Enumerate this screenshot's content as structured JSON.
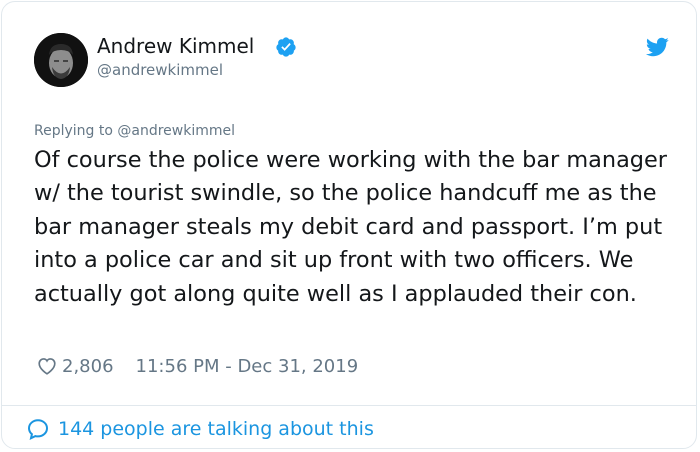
{
  "author": {
    "name": "Andrew Kimmel",
    "handle": "@andrewkimmel",
    "verified": true
  },
  "tweet": {
    "replying_to": "Replying to @andrewkimmel",
    "text": "Of course the police were working with the bar manager w/ the tourist swindle, so the police handcuff me as the bar manager steals my debit card and passport. I’m put into a police car and sit up front with two officers. We actually got along quite well as I applauded their con.",
    "likes": "2,806",
    "timestamp": "11:56 PM - Dec 31, 2019"
  },
  "footer": {
    "talking_label": "144 people are talking about this"
  },
  "icons": {
    "verified": "verified-badge-icon",
    "twitter": "twitter-bird-icon",
    "heart": "heart-icon",
    "bubble": "speech-bubble-icon"
  },
  "colors": {
    "twitter_blue": "#1da1f2",
    "link_blue": "#1b95e0",
    "muted": "#657786",
    "text": "#14171a"
  }
}
